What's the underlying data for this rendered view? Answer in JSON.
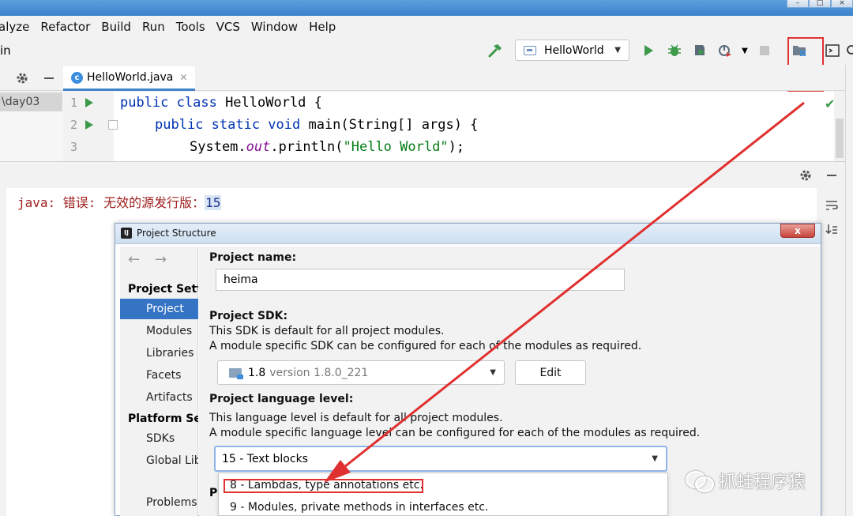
{
  "menu": {
    "items": [
      "alyze",
      "Refactor",
      "Build",
      "Run",
      "Tools",
      "VCS",
      "Window",
      "Help"
    ]
  },
  "toolbar": {
    "nav_fragment": "in",
    "run_config": "HelloWorld",
    "window_controls": [
      "–",
      "□",
      "×"
    ]
  },
  "project_tree": {
    "selected_fragment": "\\day03"
  },
  "editor": {
    "tab_label": "HelloWorld.java",
    "tab_icon_letter": "c",
    "line_numbers": [
      "1",
      "2",
      "3"
    ],
    "lines": {
      "l1_kw": "public class ",
      "l1_rest": "HelloWorld {",
      "l2_kw": "public static void ",
      "l2_rest": "main(String[] args) {",
      "l3_a": "System.",
      "l3_field": "out",
      "l3_b": ".println(",
      "l3_str": "\"Hello World\"",
      "l3_c": ");"
    }
  },
  "build_output": {
    "error_prefix": "java: 错误: 无效的源发行版：",
    "error_value": "15"
  },
  "dialog": {
    "title": "Project Structure",
    "close_label": "x",
    "sidebar": {
      "back_arrow": "←",
      "forward_arrow": "→",
      "section_project": "Project Settings",
      "items_project": [
        "Project",
        "Modules",
        "Libraries",
        "Facets",
        "Artifacts"
      ],
      "section_platform": "Platform Settings",
      "items_platform": [
        "SDKs",
        "Global Libraries"
      ],
      "problems": "Problems"
    },
    "project_name_label": "Project name:",
    "project_name_value": "heima",
    "sdk_label": "Project SDK:",
    "sdk_desc1": "This SDK is default for all project modules.",
    "sdk_desc2": "A module specific SDK can be configured for each of the modules as required.",
    "sdk_name": "1.8",
    "sdk_version": "version 1.8.0_221",
    "edit_button": "Edit",
    "lang_label": "Project language level:",
    "lang_desc1": "This language level is default for all project modules.",
    "lang_desc2": "A module specific language level can be configured for each of the modules as required.",
    "lang_selected": "15 - Text blocks",
    "lang_options": [
      "8 - Lambdas, type annotations etc.",
      "9 - Modules, private methods in interfaces etc."
    ],
    "hidden_label_fragment": "P"
  },
  "watermark": {
    "text": "抓蛙程序猿"
  },
  "colors": {
    "accent_blue": "#3574c4",
    "annotation_red": "#e03030",
    "run_green": "#3d9a4b",
    "error_red": "#a02020"
  }
}
